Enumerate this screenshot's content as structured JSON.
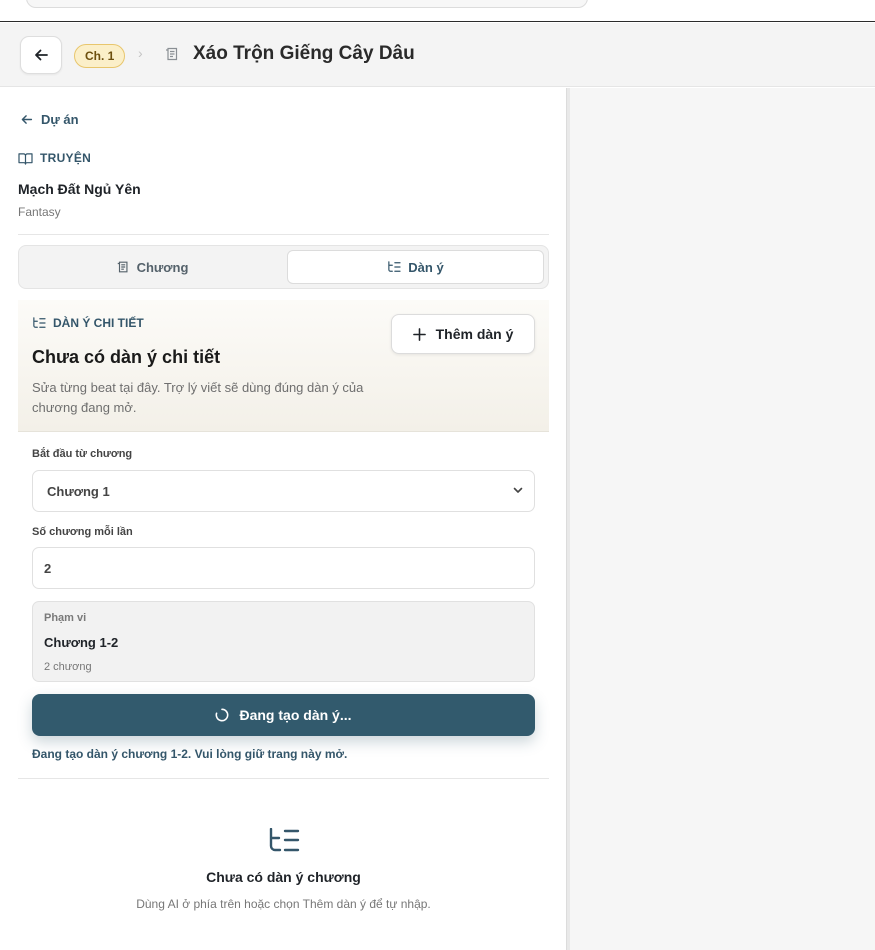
{
  "header": {
    "chapter_badge": "Ch. 1",
    "crumb_separator": "›",
    "title": "Xáo Trộn Giếng Cây Dâu"
  },
  "sidebar": {
    "back_link": "Dự án",
    "story_section_label": "TRUYỆN",
    "story_name": "Mạch Đất Ngủ Yên",
    "story_genre": "Fantasy",
    "tabs": [
      {
        "label": "Chương",
        "active": false
      },
      {
        "label": "Dàn ý",
        "active": true
      }
    ],
    "outline": {
      "label": "DÀN Ý CHI TIẾT",
      "title": "Chưa có dàn ý chi tiết",
      "description": "Sửa từng beat tại đây. Trợ lý viết sẽ dùng đúng dàn ý của chương đang mở.",
      "add_button": "Thêm dàn ý"
    },
    "form": {
      "start_label": "Bắt đầu từ chương",
      "start_value": "Chương 1",
      "count_label": "Số chương mỗi lần",
      "count_value": "2",
      "range_label": "Phạm vi",
      "range_value": "Chương 1-2",
      "range_count": "2 chương",
      "generate_button": "Đang tạo dàn ý...",
      "status": "Đang tạo dàn ý chương 1-2. Vui lòng giữ trang này mở."
    },
    "empty_state": {
      "title": "Chưa có dàn ý chương",
      "description": "Dùng AI ở phía trên hoặc chọn Thêm dàn ý để tự nhập."
    }
  },
  "icons": {
    "back": "arrow-left-icon",
    "chapter": "scroll-icon",
    "story": "book-open-icon",
    "outline": "list-tree-icon",
    "add": "plus-icon",
    "spinner": "spinner-icon",
    "select": "chevron-down-icon"
  },
  "colors": {
    "accent": "#325a6d",
    "accent_text": "#34566a",
    "badge_bg": "#fbefc9",
    "badge_border": "#e8c66d"
  }
}
